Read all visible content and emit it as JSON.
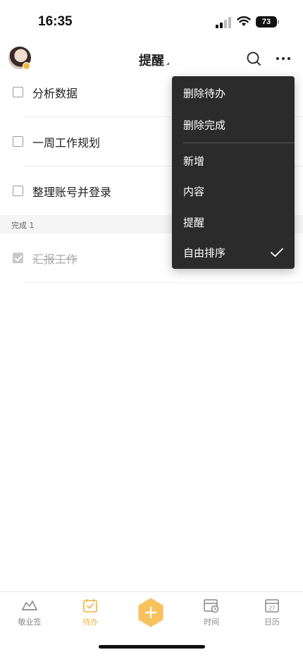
{
  "status_bar": {
    "time": "16:35",
    "battery": "73"
  },
  "header": {
    "title": "提醒"
  },
  "tasks": [
    {
      "label": "分析数据"
    },
    {
      "label": "一周工作规划"
    },
    {
      "label": "整理账号并登录"
    }
  ],
  "completed_section": {
    "label": "完成 1"
  },
  "completed_tasks": [
    {
      "label": "汇报工作"
    }
  ],
  "menu": {
    "items": [
      {
        "label": "删除待办"
      },
      {
        "label": "删除完成"
      },
      {
        "label": "新增"
      },
      {
        "label": "内容"
      },
      {
        "label": "提醒"
      },
      {
        "label": "自由排序",
        "checked": true
      }
    ]
  },
  "tabbar": {
    "tabs": [
      {
        "label": "敬业签",
        "icon": "cloud-note-icon"
      },
      {
        "label": "待办",
        "icon": "calendar-check-icon",
        "active": true
      },
      {
        "label": "",
        "icon": "add-icon"
      },
      {
        "label": "时间",
        "icon": "calendar-clock-icon"
      },
      {
        "label": "日历",
        "icon": "calendar-day-icon",
        "day": "27"
      }
    ]
  },
  "colors": {
    "accent": "#f1b442",
    "menu_bg": "#2b2b2b",
    "section_bg": "#f5f5f5"
  }
}
